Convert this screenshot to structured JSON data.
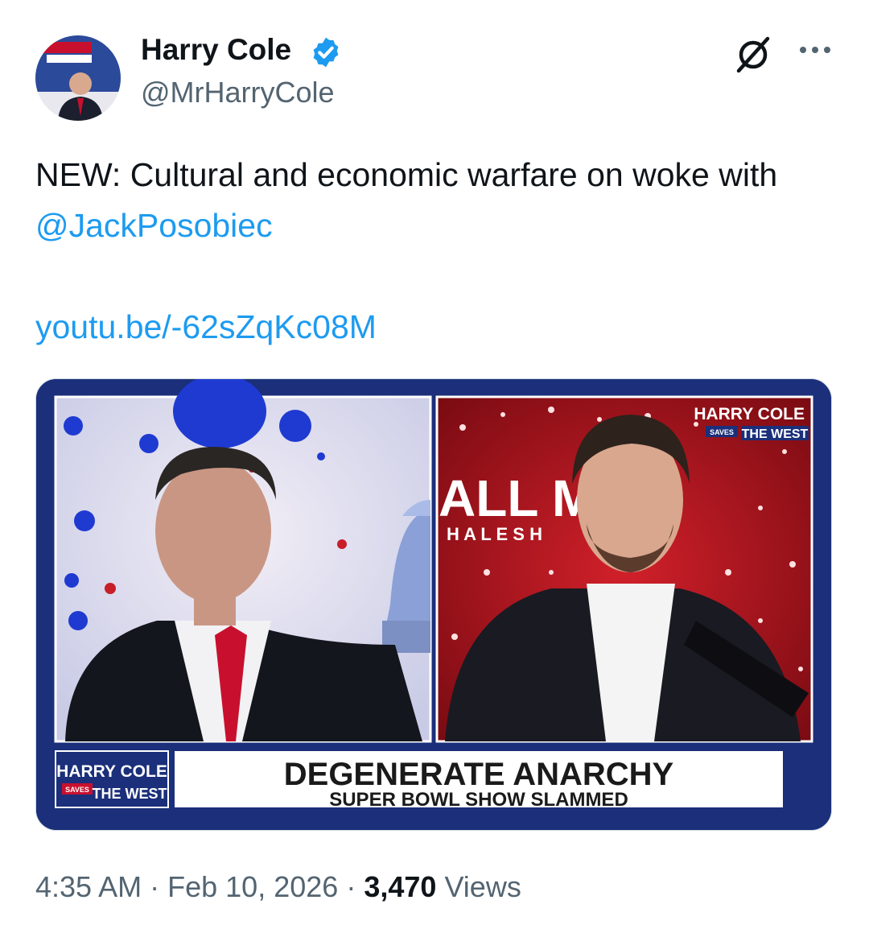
{
  "author": {
    "display_name": "Harry Cole",
    "handle": "@MrHarryCole",
    "verified": true,
    "avatar_icon": "avatar",
    "verified_icon": "verified-badge-icon"
  },
  "header": {
    "grok_icon": "grok-icon",
    "more_icon": "more-options-icon"
  },
  "tweet": {
    "text_before_mention": "NEW: Cultural and economic warfare on woke with ",
    "mention": "@JackPosobiec",
    "link": "youtu.be/-62sZqKc08M"
  },
  "media": {
    "top_right_logo_line1": "HARRY COLE",
    "top_right_logo_saves": "SAVES",
    "top_right_logo_line2": "THE WEST",
    "background_sign_top": "ALL   MERI",
    "background_sign_sub": "H A L         E   S H",
    "lower_third_logo_line1": "HARRY COLE",
    "lower_third_logo_saves": "SAVES",
    "lower_third_logo_line2": "THE WEST",
    "headline": "DEGENERATE ANARCHY",
    "subheadline": "SUPER BOWL SHOW SLAMMED"
  },
  "meta": {
    "time": "4:35 AM",
    "separator": "·",
    "date": "Feb 10, 2026",
    "views_count": "3,470",
    "views_label": "Views"
  },
  "colors": {
    "brand_blue": "#1d9bf0",
    "text_primary": "#0f1419",
    "text_secondary": "#536471",
    "broadcast_navy": "#1b2f7a",
    "broadcast_red": "#c8102e"
  }
}
